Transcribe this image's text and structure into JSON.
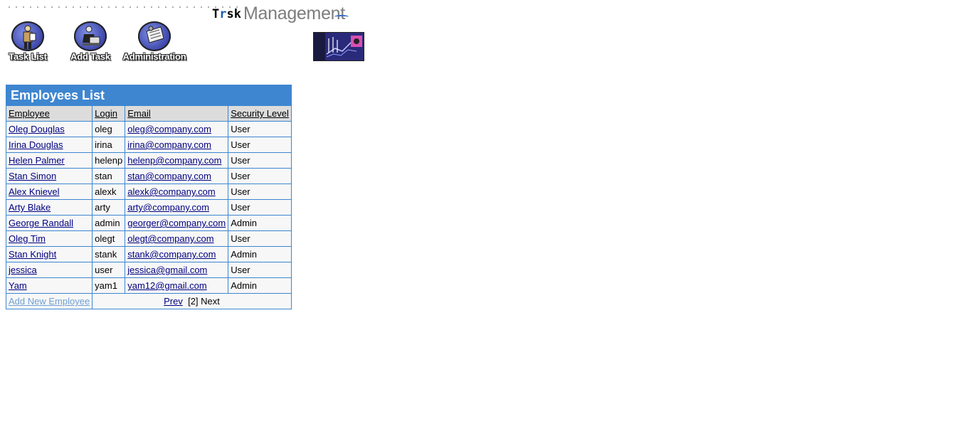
{
  "logo": {
    "part1_a": "T",
    "part1_b": "r",
    "part1_c": "sk",
    "part2": "Managem",
    "part3": "nt",
    "part2_e": "e"
  },
  "nav": {
    "task_list": "Task List",
    "add_task": "Add Task",
    "administration": "Administration"
  },
  "table": {
    "title": "Employees List",
    "headers": {
      "employee": "Employee",
      "login": "Login",
      "email": "Email",
      "security_level": "Security Level"
    },
    "rows": [
      {
        "employee": "Oleg Douglas",
        "login": "oleg",
        "email": "oleg@company.com",
        "level": "User"
      },
      {
        "employee": "Irina Douglas",
        "login": "irina",
        "email": "irina@company.com",
        "level": "User"
      },
      {
        "employee": "Helen Palmer",
        "login": "helenp",
        "email": "helenp@company.com",
        "level": "User"
      },
      {
        "employee": "Stan Simon",
        "login": "stan",
        "email": "stan@company.com",
        "level": "User"
      },
      {
        "employee": "Alex Knievel",
        "login": "alexk",
        "email": "alexk@company.com",
        "level": "User"
      },
      {
        "employee": "Arty Blake",
        "login": "arty",
        "email": "arty@company.com",
        "level": "User"
      },
      {
        "employee": "George Randall",
        "login": "admin",
        "email": "georger@company.com",
        "level": "Admin"
      },
      {
        "employee": "Oleg Tim",
        "login": "olegt",
        "email": "olegt@company.com",
        "level": "User"
      },
      {
        "employee": "Stan Knight",
        "login": "stank",
        "email": "stank@company.com",
        "level": "Admin"
      },
      {
        "employee": "jessica",
        "login": "user",
        "email": "jessica@gmail.com",
        "level": "User"
      },
      {
        "employee": "Yam",
        "login": "yam1",
        "email": "yam12@gmail.com",
        "level": "Admin"
      }
    ],
    "footer": {
      "add_new": "Add New Employee",
      "prev": "Prev",
      "page": "[2]",
      "next": "Next"
    }
  },
  "colors": {
    "header_blue": "#3e86d0",
    "link": "#000080",
    "header_gray": "#dcdcdc"
  }
}
